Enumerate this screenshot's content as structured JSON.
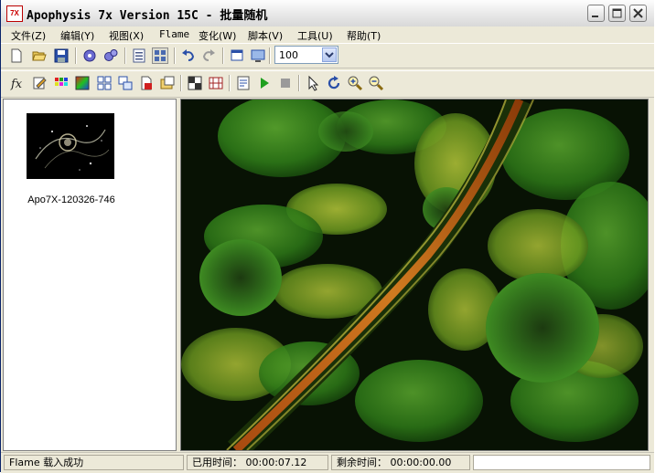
{
  "window": {
    "title": "Apophysis 7x Version 15C - 批量随机",
    "app_icon_text": "7X"
  },
  "menu": [
    {
      "label": "文件(Z)"
    },
    {
      "label": "编辑(Y)"
    },
    {
      "label": "视图(X)"
    },
    {
      "label": "Flame"
    },
    {
      "label": "变化(W)"
    },
    {
      "label": "脚本(V)"
    },
    {
      "label": "工具(U)"
    },
    {
      "label": "帮助(T)"
    }
  ],
  "toolbar": {
    "zoom_value": "100"
  },
  "browser": {
    "items": [
      {
        "label": "Apo7X-120326-746"
      }
    ]
  },
  "status": {
    "message": "Flame 载入成功",
    "elapsed": "已用时间： 00:00:07.12",
    "remaining": "剩余时间： 00:00:00.00",
    "extra": ""
  },
  "colors": {
    "render_bg": "#0a1404",
    "leaf_green": "#3c8a1e",
    "leaf_yellow": "#b6c93a",
    "stripe_orange": "#c86a1a"
  }
}
